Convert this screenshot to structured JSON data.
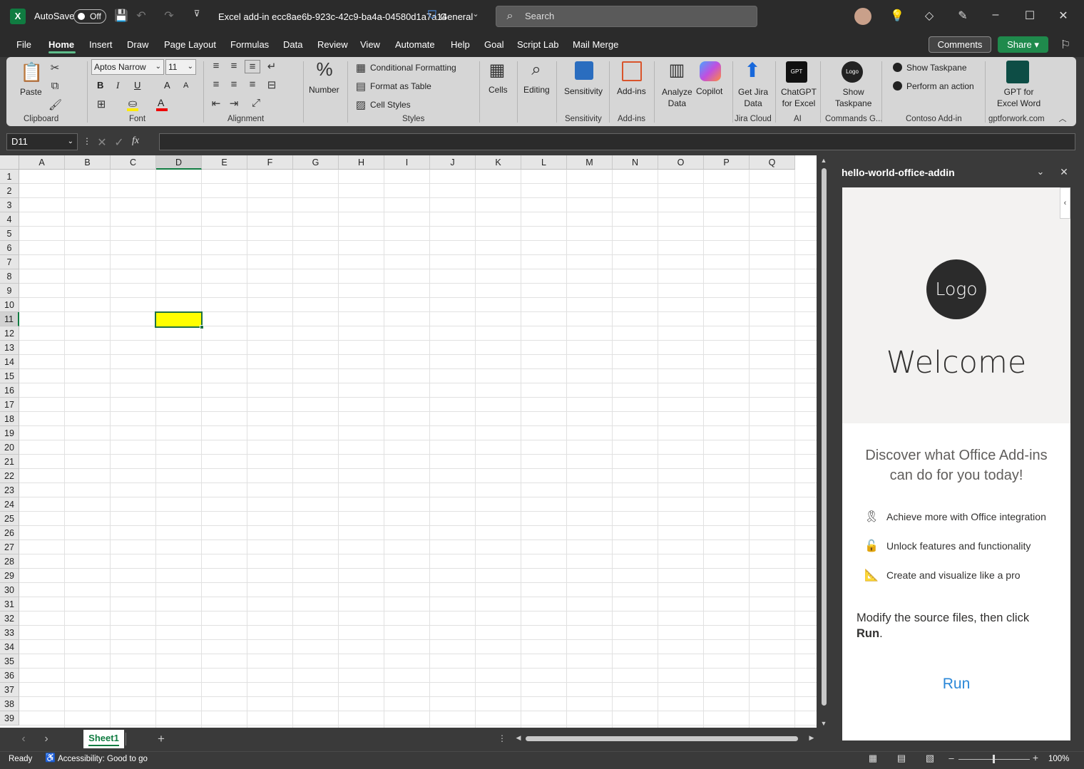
{
  "titlebar": {
    "autosave_label": "AutoSave",
    "autosave_state": "Off",
    "file_title": "Excel add-in ecc8ae6b-923c-42c9-ba4a-04580d1a7a14",
    "sensitivity": "General",
    "search_placeholder": "Search"
  },
  "tabs": [
    "File",
    "Home",
    "Insert",
    "Draw",
    "Page Layout",
    "Formulas",
    "Data",
    "Review",
    "View",
    "Automate",
    "Help",
    "Goal",
    "Script Lab",
    "Mail Merge"
  ],
  "actions": {
    "comments": "Comments",
    "share": "Share"
  },
  "ribbon": {
    "clipboard": {
      "paste": "Paste",
      "group": "Clipboard"
    },
    "font": {
      "name": "Aptos Narrow",
      "size": "11",
      "group": "Font",
      "bold": "B",
      "italic": "I",
      "underline": "U",
      "grow": "A",
      "shrink": "A"
    },
    "alignment": {
      "group": "Alignment"
    },
    "number": {
      "label": "Number"
    },
    "styles": {
      "conditional": "Conditional Formatting",
      "format_table": "Format as Table",
      "cell_styles": "Cell Styles",
      "group": "Styles"
    },
    "cells": {
      "label": "Cells"
    },
    "editing": {
      "label": "Editing"
    },
    "sensitivity": {
      "label": "Sensitivity",
      "group": "Sensitivity"
    },
    "addins": {
      "label": "Add-ins",
      "group": "Add-ins"
    },
    "analyze": {
      "line1": "Analyze",
      "line2": "Data"
    },
    "copilot": {
      "label": "Copilot"
    },
    "jira": {
      "line1": "Get Jira",
      "line2": "Data",
      "group": "Jira Cloud"
    },
    "chatgpt": {
      "line1": "ChatGPT",
      "line2": "for Excel",
      "group": "AI",
      "icon_text": "GPT"
    },
    "show_taskpane": {
      "line1": "Show",
      "line2": "Taskpane",
      "group": "Commands G...",
      "icon_text": "Logo"
    },
    "contoso": {
      "show": "Show Taskpane",
      "perform": "Perform an action",
      "group": "Contoso Add-in"
    },
    "gptword": {
      "line1": "GPT for",
      "line2": "Excel Word",
      "group": "gptforwork.com"
    }
  },
  "formula_bar": {
    "name_box": "D11",
    "fx": "fx",
    "formula": ""
  },
  "grid": {
    "columns": [
      "A",
      "B",
      "C",
      "D",
      "E",
      "F",
      "G",
      "H",
      "I",
      "J",
      "K",
      "L",
      "M",
      "N",
      "O",
      "P",
      "Q"
    ],
    "rows": [
      "1",
      "2",
      "3",
      "4",
      "5",
      "6",
      "7",
      "8",
      "9",
      "10",
      "11",
      "12",
      "13",
      "14",
      "15",
      "16",
      "17",
      "18",
      "19",
      "20",
      "21",
      "22",
      "23",
      "24",
      "25",
      "26",
      "27",
      "28",
      "29",
      "30",
      "31",
      "32",
      "33",
      "34",
      "35",
      "36",
      "37",
      "38",
      "39"
    ],
    "selected_cell": "D11",
    "selected_fill": "#ffff00"
  },
  "sheets": {
    "active": "Sheet1",
    "add": "+"
  },
  "status": {
    "ready": "Ready",
    "accessibility": "Accessibility: Good to go",
    "zoom": "100%"
  },
  "taskpane": {
    "title": "hello-world-office-addin",
    "logo": "Logo",
    "welcome": "Welcome",
    "discover": "Discover what Office Add-ins can do for you today!",
    "features": [
      {
        "icon": "ribbon-icon",
        "text": "Achieve more with Office integration"
      },
      {
        "icon": "unlock-icon",
        "text": "Unlock features and functionality"
      },
      {
        "icon": "design-icon",
        "text": "Create and visualize like a pro"
      }
    ],
    "modify_text": "Modify the source files, then click ",
    "modify_bold": "Run",
    "modify_end": ".",
    "run": "Run"
  },
  "colors": {
    "accent": "#107c41",
    "share": "#1f8a4c",
    "run_link": "#2b88d8"
  }
}
